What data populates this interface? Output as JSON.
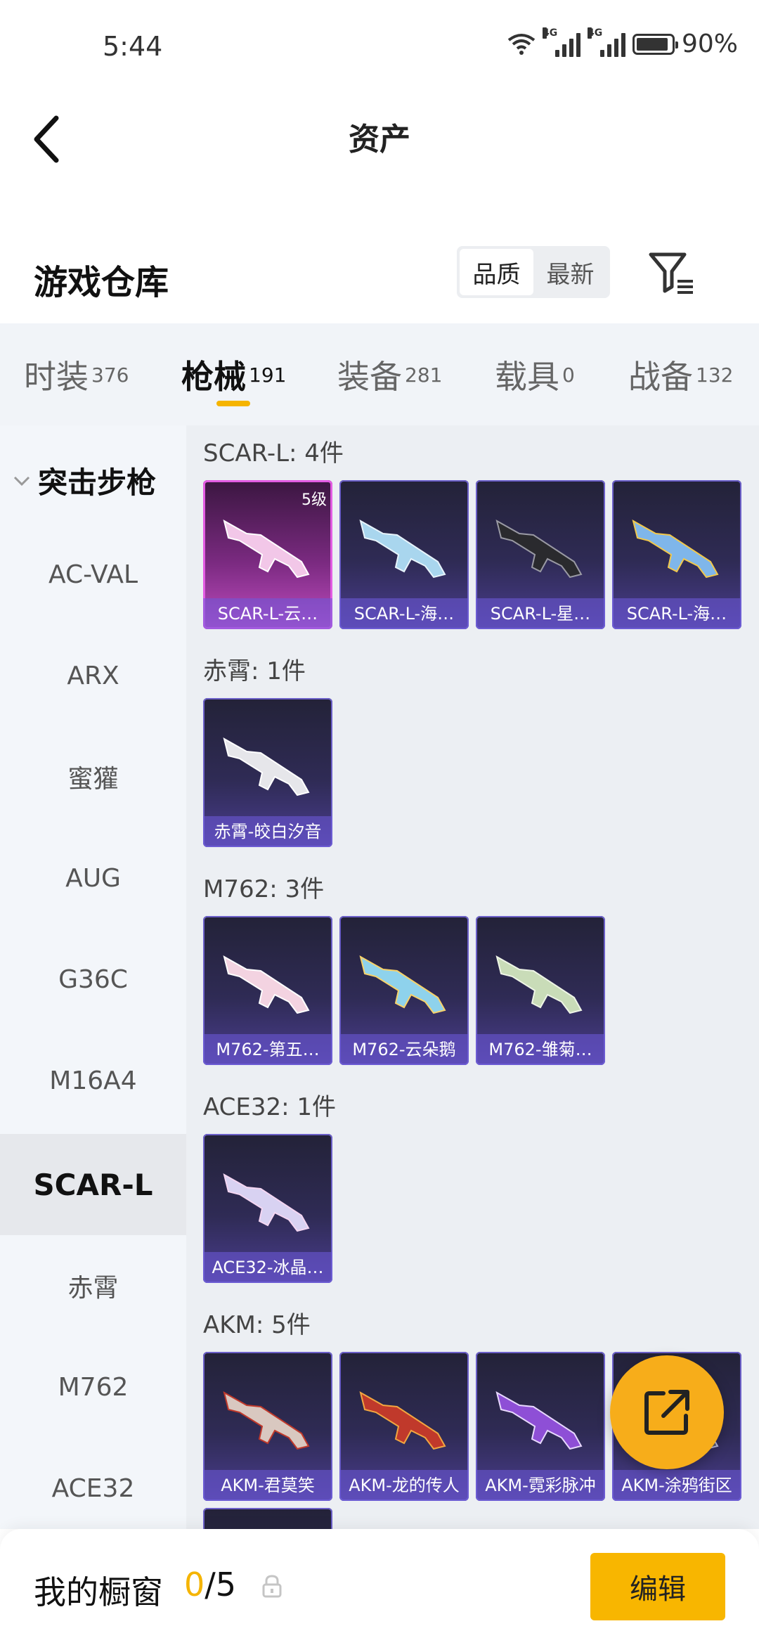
{
  "status_bar": {
    "time": "5:44",
    "signal1_label": "4G",
    "signal2_label": "4G",
    "battery": "90%"
  },
  "nav": {
    "title": "资产"
  },
  "warehouse": {
    "title": "游戏仓库",
    "sort_options": [
      "品质",
      "最新"
    ],
    "sort_selected": "品质"
  },
  "tabs": [
    {
      "label": "时装",
      "count": "376"
    },
    {
      "label": "枪械",
      "count": "191",
      "active": true
    },
    {
      "label": "装备",
      "count": "281"
    },
    {
      "label": "载具",
      "count": "0"
    },
    {
      "label": "战备",
      "count": "132"
    }
  ],
  "sidebar": {
    "header": "突击步枪",
    "items": [
      "AC-VAL",
      "ARX",
      "蜜獾",
      "AUG",
      "G36C",
      "M16A4",
      "SCAR-L",
      "赤霄",
      "M762",
      "ACE32"
    ],
    "active": "SCAR-L"
  },
  "groups": [
    {
      "label": "SCAR-L: 4件",
      "items": [
        {
          "name": "SCAR-L-云…",
          "level": "5级",
          "quality": "pink",
          "icon": "rifle-pink-icon"
        },
        {
          "name": "SCAR-L-海…",
          "icon": "rifle-blue-icon"
        },
        {
          "name": "SCAR-L-星…",
          "icon": "rifle-dark-icon"
        },
        {
          "name": "SCAR-L-海…",
          "icon": "rifle-blue-gold-icon"
        }
      ]
    },
    {
      "label": "赤霄: 1件",
      "items": [
        {
          "name": "赤霄-皎白汐音",
          "icon": "rifle-white-icon"
        }
      ]
    },
    {
      "label": "M762: 3件",
      "items": [
        {
          "name": "M762-第五…",
          "icon": "rifle-pink-white-icon"
        },
        {
          "name": "M762-云朵鹅",
          "icon": "rifle-blue-icon"
        },
        {
          "name": "M762-雏菊…",
          "icon": "rifle-green-icon"
        }
      ]
    },
    {
      "label": "ACE32: 1件",
      "items": [
        {
          "name": "ACE32-冰晶…",
          "icon": "rifle-crystal-icon"
        }
      ]
    },
    {
      "label": "AKM: 5件",
      "items": [
        {
          "name": "AKM-君莫笑",
          "icon": "rifle-red-icon"
        },
        {
          "name": "AKM-龙的传人",
          "icon": "rifle-orange-icon"
        },
        {
          "name": "AKM-霓彩脉冲",
          "icon": "rifle-purple-icon"
        },
        {
          "name": "AKM-涂鸦街区",
          "icon": "rifle-graffiti-icon"
        }
      ]
    }
  ],
  "showcase": {
    "label": "我的橱窗",
    "used": "0",
    "total": "/5",
    "edit_label": "编辑"
  },
  "colors": {
    "accent": "#f5b400",
    "fab": "#f7ad1a",
    "card_quality_pink": "#e35ce3",
    "card_quality_purple": "#6b5fc8"
  }
}
